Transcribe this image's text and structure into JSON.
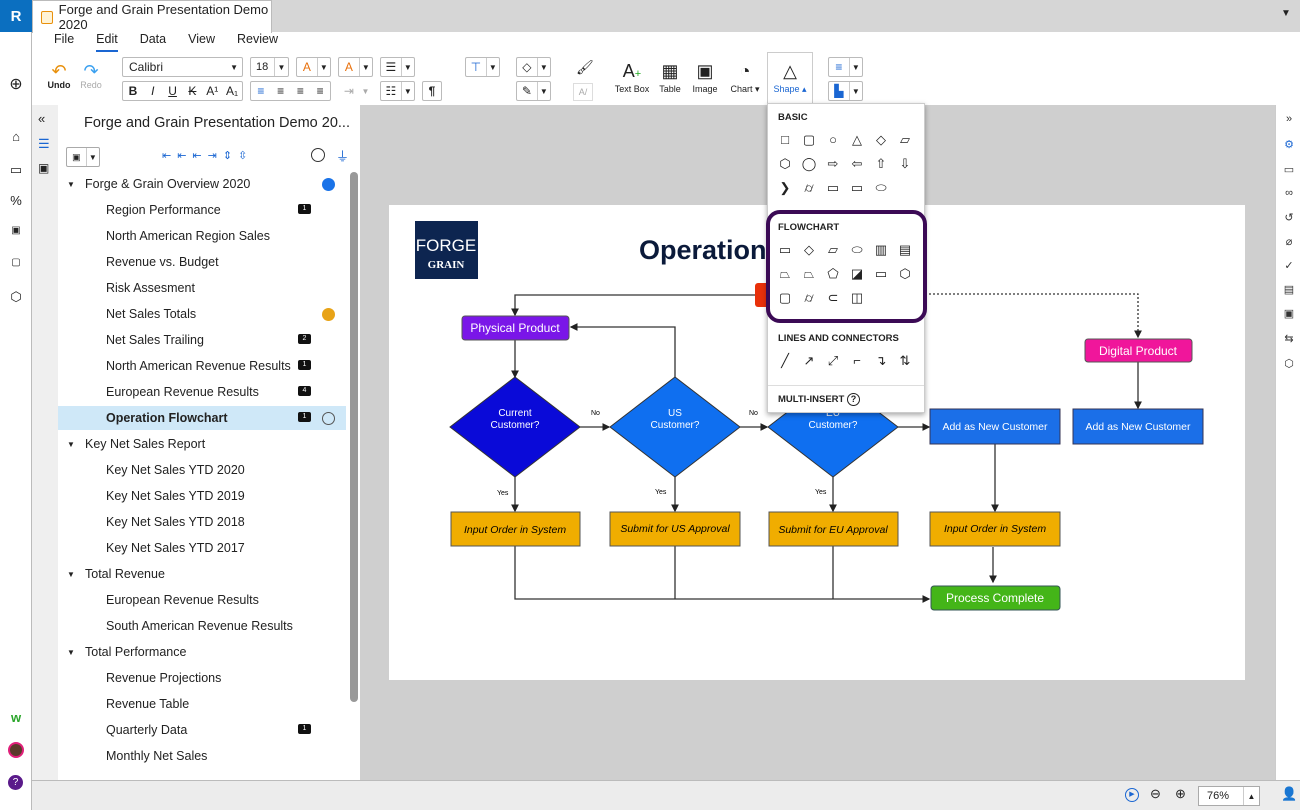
{
  "app": {
    "logo": "R",
    "doc_title": "Forge and Grain Presentation Demo 2020"
  },
  "menu": [
    "File",
    "Edit",
    "Data",
    "View",
    "Review"
  ],
  "toolbar": {
    "undo": "Undo",
    "redo": "Redo",
    "font": "Calibri",
    "size": "18",
    "text_box": "Text Box",
    "table": "Table",
    "image": "Image",
    "chart": "Chart",
    "shape": "Shape"
  },
  "outline": {
    "title": "Forge and Grain Presentation Demo 20...",
    "items": [
      {
        "label": "Forge & Grain Overview 2020",
        "level": 0,
        "dot": "#1a73e8"
      },
      {
        "label": "Region Performance",
        "level": 1,
        "badge": "1"
      },
      {
        "label": "North American Region Sales",
        "level": 1
      },
      {
        "label": "Revenue vs. Budget",
        "level": 1
      },
      {
        "label": "Risk Assesment",
        "level": 1
      },
      {
        "label": "Net Sales Totals",
        "level": 1,
        "dot": "#e8a317"
      },
      {
        "label": "Net Sales Trailing",
        "level": 1,
        "badge": "2"
      },
      {
        "label": "North American Revenue Results",
        "level": 1,
        "badge": "1"
      },
      {
        "label": "European Revenue Results",
        "level": 1,
        "badge": "4"
      },
      {
        "label": "Operation Flowchart",
        "level": 1,
        "badge": "1",
        "selected": true
      },
      {
        "label": "Key Net Sales Report",
        "level": 0
      },
      {
        "label": "Key Net Sales YTD 2020",
        "level": 1
      },
      {
        "label": "Key Net Sales YTD 2019",
        "level": 1
      },
      {
        "label": "Key Net Sales YTD 2018",
        "level": 1
      },
      {
        "label": "Key Net Sales YTD 2017",
        "level": 1
      },
      {
        "label": "Total Revenue",
        "level": 0
      },
      {
        "label": "European Revenue Results",
        "level": 1
      },
      {
        "label": "South American Revenue Results",
        "level": 1
      },
      {
        "label": "Total Performance",
        "level": 0
      },
      {
        "label": "Revenue Projections",
        "level": 1
      },
      {
        "label": "Revenue Table",
        "level": 1
      },
      {
        "label": "Quarterly Data",
        "level": 1,
        "badge": "1"
      },
      {
        "label": "Monthly Net Sales",
        "level": 1
      }
    ]
  },
  "shape_menu": {
    "basic": "BASIC",
    "flowchart": "FLOWCHART",
    "lines": "LINES AND CONNECTORS",
    "multi": "MULTI-INSERT"
  },
  "slide": {
    "logo_top": "FORGE",
    "logo_bottom": "GRAIN",
    "title": "Operation Flowchart",
    "physical": "Physical Product",
    "digital": "Digital Product",
    "d1a": "Current",
    "d1b": "Customer?",
    "d2a": "US",
    "d2b": "Customer?",
    "d3a": "EU",
    "d3b": "Customer?",
    "no": "No",
    "yes": "Yes",
    "input1": "Input Order in System",
    "us_approval": "Submit for US Approval",
    "eu_approval": "Submit for EU Approval",
    "input2": "Input Order in System",
    "new1": "Add as New Customer",
    "new2": "Add as New Customer",
    "complete": "Process Complete"
  },
  "status": {
    "zoom": "76%"
  },
  "colors": {
    "accent": "#1a66d2",
    "purple": "#7a16e8",
    "magenta": "#f0169b",
    "navy": "#0a0ad8",
    "blue": "#0f6ff0",
    "yellow": "#f0ad00",
    "green": "#44b518",
    "highlight": "#3b0a55"
  }
}
